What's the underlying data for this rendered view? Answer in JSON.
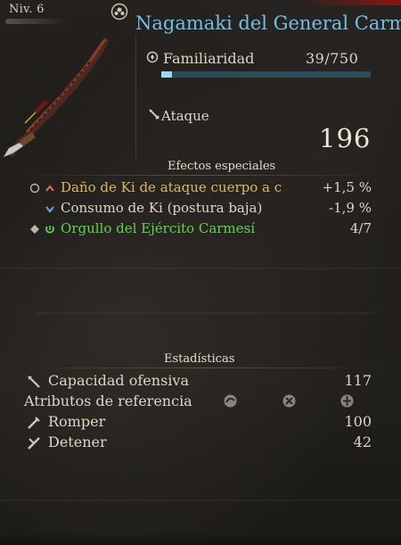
{
  "header": {
    "level": "Niv. 6",
    "weapon_name": "Nagamaki del General Carm"
  },
  "familiarity": {
    "label": "Familiaridad",
    "value": "39/750",
    "progress": 0.052
  },
  "attack": {
    "label": "Ataque",
    "value": "196"
  },
  "special_effects": {
    "title": "Efectos especiales",
    "items": [
      {
        "text": "Daño de Ki de ataque cuerpo a c",
        "value": "+1,5 %",
        "color": "#e0b85a",
        "icon": "up-arrow-icon"
      },
      {
        "text": "Consumo de Ki (postura baja)",
        "value": "-1,9 %",
        "color": "#ddd6c6",
        "icon": "down-arrow-icon"
      },
      {
        "text": "Orgullo del Ejército Carmesí",
        "value": "4/7",
        "color": "#5fd44a",
        "icon": "set-bonus-icon"
      }
    ]
  },
  "statistics": {
    "title": "Estadísticas",
    "offensive_label": "Capacidad ofensiva",
    "offensive_value": "117",
    "attributes_label": "Atributos de referencia",
    "break_label": "Romper",
    "break_value": "100",
    "parry_label": "Detener",
    "parry_value": "42"
  },
  "colors": {
    "title_blue": "#6fc0e6",
    "familiarity_bar": "#9fd6ef",
    "effect_gold": "#e0b85a",
    "set_green": "#5fd44a"
  }
}
